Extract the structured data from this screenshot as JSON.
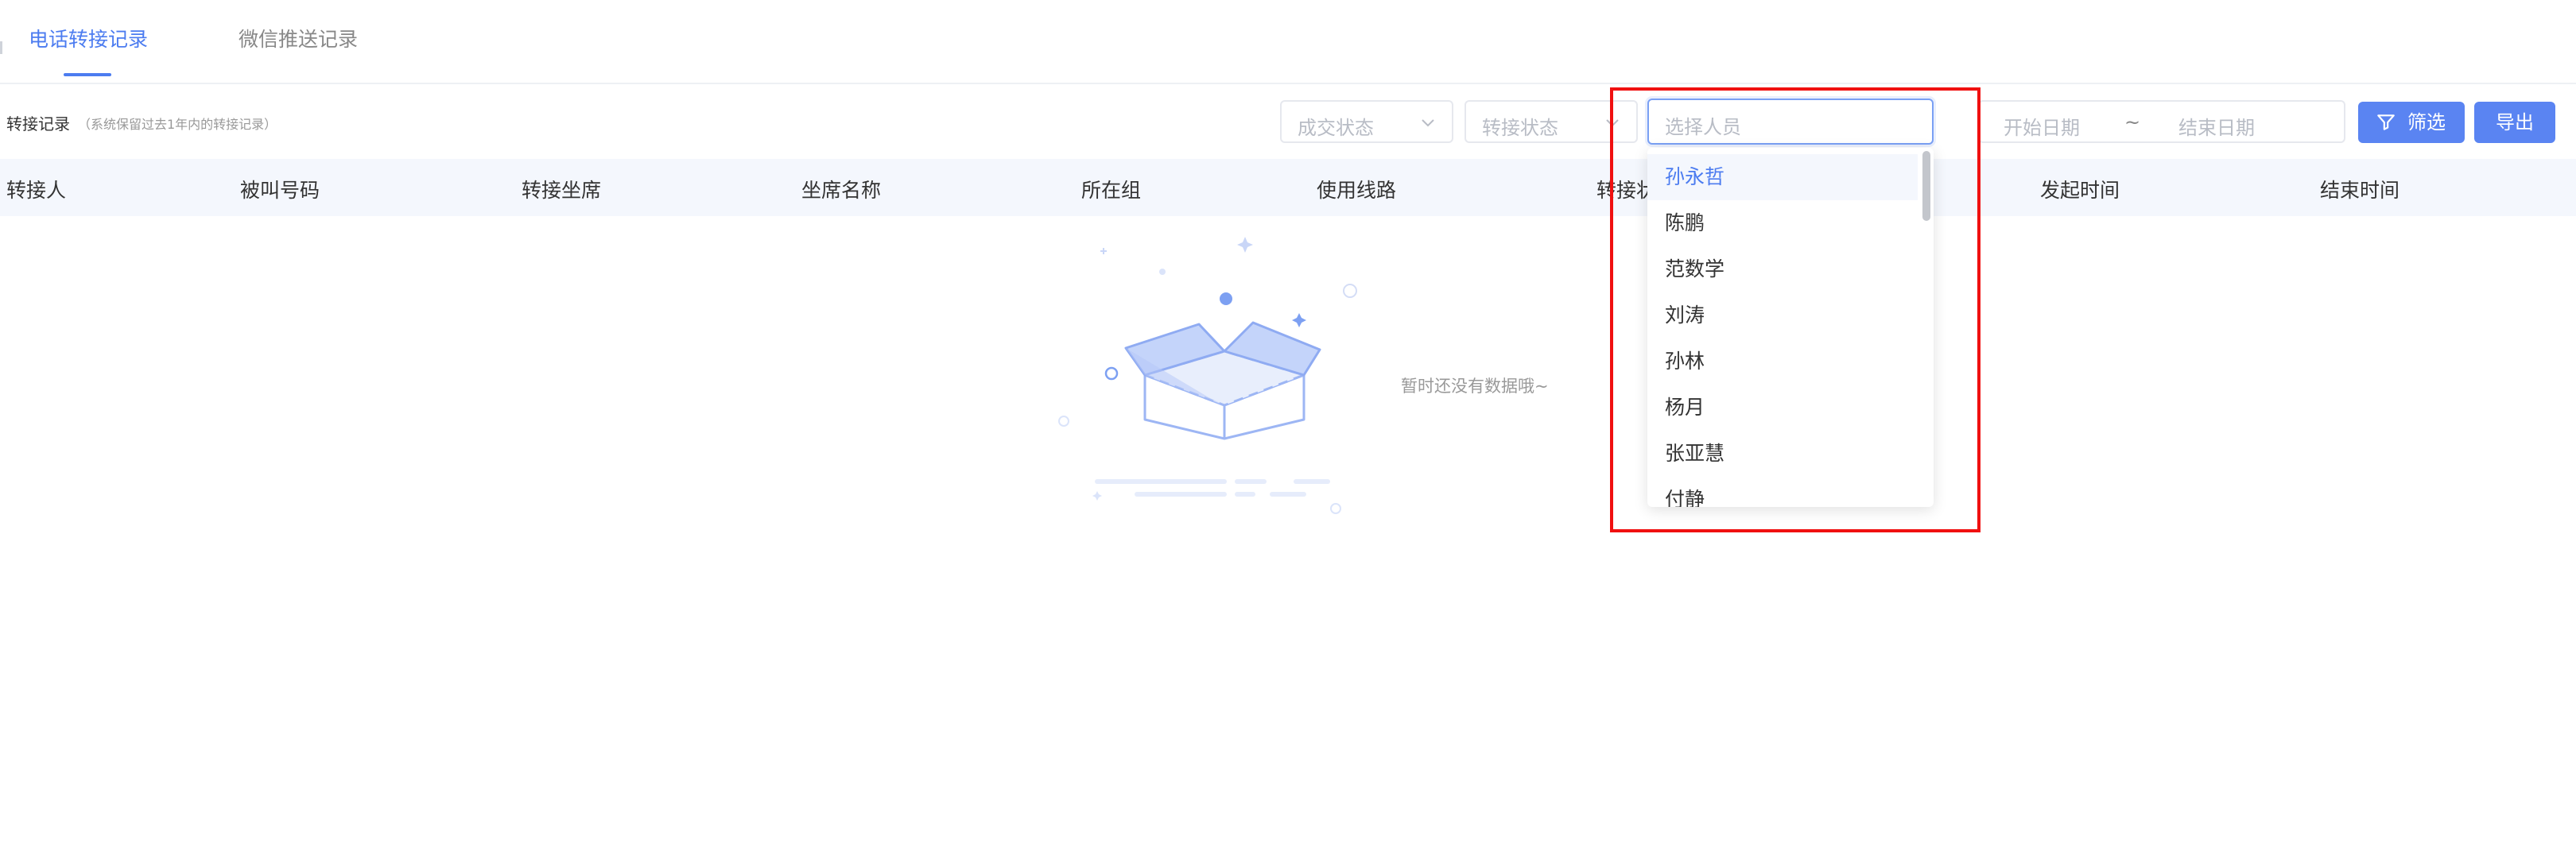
{
  "tabs": [
    {
      "label": "电话转接记录",
      "active": true
    },
    {
      "label": "微信推送记录",
      "active": false
    }
  ],
  "section": {
    "title": "转接记录",
    "note": "（系统保留过去1年内的转接记录）"
  },
  "filters": {
    "deal_status_placeholder": "成交状态",
    "transfer_status_placeholder": "转接状态",
    "person_placeholder": "选择人员",
    "start_date_placeholder": "开始日期",
    "date_separator": "~",
    "end_date_placeholder": "结束日期",
    "filter_button": "筛选",
    "export_button": "导出"
  },
  "table": {
    "columns": [
      "转接人",
      "被叫号码",
      "转接坐席",
      "坐席名称",
      "所在组",
      "使用线路",
      "转接状态",
      "发起时间",
      "结束时间"
    ]
  },
  "empty_state": {
    "text": "暂时还没有数据哦~"
  },
  "person_dropdown": {
    "options": [
      "孙永哲",
      "陈鹏",
      "范数学",
      "刘涛",
      "孙林",
      "杨月",
      "张亚慧",
      "付静"
    ],
    "selected_index": 0
  },
  "colors": {
    "accent": "#4c7cf0",
    "button": "#5a84f2",
    "highlight": "#f01010",
    "header_bg": "#f4f7fd"
  }
}
